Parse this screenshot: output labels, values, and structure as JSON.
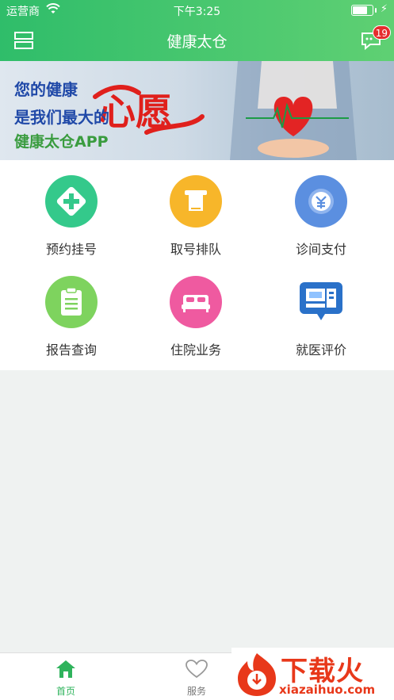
{
  "status_bar": {
    "carrier": "运营商",
    "time": "下午3:25"
  },
  "navbar": {
    "title": "健康太仓",
    "message_badge": "19"
  },
  "banner": {
    "line1": "您的健康",
    "line2": "是我们最大的",
    "line3": "健康太仓APP",
    "highlight": "心愿"
  },
  "services": [
    {
      "label": "预约挂号",
      "icon": "plus-cross-icon",
      "color": "#32c98a"
    },
    {
      "label": "取号排队",
      "icon": "ticket-icon",
      "color": "#f7b62a"
    },
    {
      "label": "诊间支付",
      "icon": "yuan-coin-icon",
      "color": "#5b8fe0"
    },
    {
      "label": "报告查询",
      "icon": "clipboard-icon",
      "color": "#7ed35e"
    },
    {
      "label": "住院业务",
      "icon": "bed-icon",
      "color": "#ef5aa0"
    },
    {
      "label": "就医评价",
      "icon": "monitor-icon",
      "color": "#2a71c9"
    }
  ],
  "tabbar": {
    "home_label": "首页",
    "service_label": "服务",
    "active_color": "#2fb35c"
  },
  "watermark": {
    "brand": "下载火",
    "domain": "xiazaihuo.com"
  }
}
